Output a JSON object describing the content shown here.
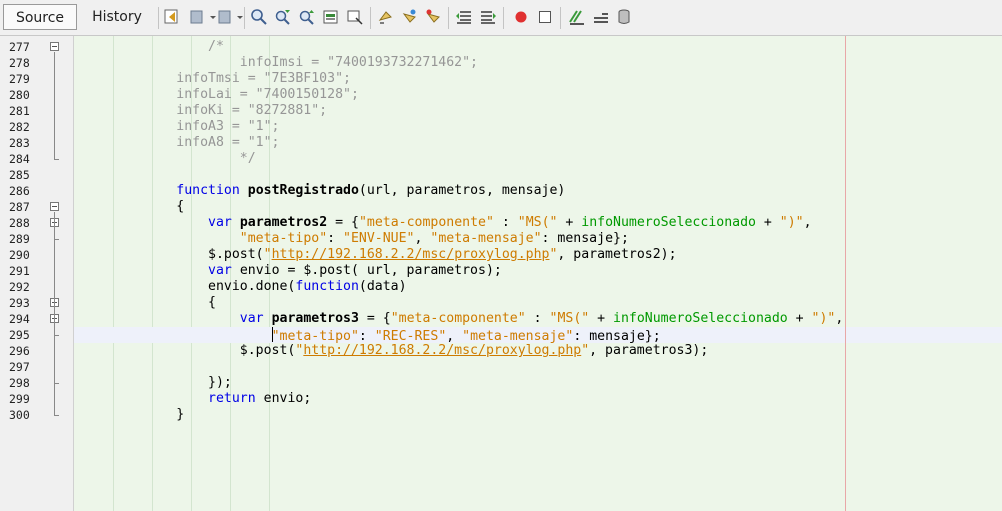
{
  "tabs": {
    "source": "Source",
    "history": "History"
  },
  "toolbar_icons": [
    "last-edit-icon",
    "back-icon",
    "forward-icon",
    "find-selection-icon",
    "find-previous-icon",
    "find-next-icon",
    "toggle-highlight-icon",
    "toggle-rect-selection-icon",
    "previous-bookmark-icon",
    "next-bookmark-icon",
    "toggle-bookmark-icon",
    "shift-left-icon",
    "shift-right-icon",
    "record-macro-icon",
    "stop-macro-icon",
    "comment-icon",
    "uncomment-icon",
    "database-icon"
  ],
  "lines": [
    {
      "n": "277",
      "tokens": [
        {
          "t": "                /*",
          "c": "cm"
        }
      ]
    },
    {
      "n": "278",
      "tokens": [
        {
          "t": "                    infoImsi = \"7400193732271462\";",
          "c": "cm"
        }
      ]
    },
    {
      "n": "279",
      "tokens": [
        {
          "t": "            infoTmsi = \"7E3BF103\";",
          "c": "cm"
        }
      ]
    },
    {
      "n": "280",
      "tokens": [
        {
          "t": "            infoLai = \"7400150128\";",
          "c": "cm"
        }
      ]
    },
    {
      "n": "281",
      "tokens": [
        {
          "t": "            infoKi = \"8272881\";",
          "c": "cm"
        }
      ]
    },
    {
      "n": "282",
      "tokens": [
        {
          "t": "            infoA3 = \"1\";",
          "c": "cm"
        }
      ]
    },
    {
      "n": "283",
      "tokens": [
        {
          "t": "            infoA8 = \"1\";",
          "c": "cm"
        }
      ]
    },
    {
      "n": "284",
      "tokens": [
        {
          "t": "                    */",
          "c": "cm"
        }
      ]
    },
    {
      "n": "285",
      "tokens": []
    },
    {
      "n": "286",
      "tokens": [
        {
          "t": "            "
        },
        {
          "t": "function",
          "c": "kw"
        },
        {
          "t": " "
        },
        {
          "t": "postRegistrado",
          "c": "fn"
        },
        {
          "t": "(url, parametros, mensaje)"
        }
      ]
    },
    {
      "n": "287",
      "tokens": [
        {
          "t": "            {"
        }
      ]
    },
    {
      "n": "288",
      "tokens": [
        {
          "t": "                "
        },
        {
          "t": "var",
          "c": "kw"
        },
        {
          "t": " "
        },
        {
          "t": "parametros2",
          "c": "fn"
        },
        {
          "t": " = {"
        },
        {
          "t": "\"meta-componente\"",
          "c": "str"
        },
        {
          "t": " : "
        },
        {
          "t": "\"MS(\"",
          "c": "str"
        },
        {
          "t": " + "
        },
        {
          "t": "infoNumeroSeleccionado",
          "c": "fld"
        },
        {
          "t": " + "
        },
        {
          "t": "\")\"",
          "c": "str"
        },
        {
          "t": ","
        }
      ]
    },
    {
      "n": "289",
      "tokens": [
        {
          "t": "                    "
        },
        {
          "t": "\"meta-tipo\"",
          "c": "str"
        },
        {
          "t": ": "
        },
        {
          "t": "\"ENV-NUE\"",
          "c": "str"
        },
        {
          "t": ", "
        },
        {
          "t": "\"meta-mensaje\"",
          "c": "str"
        },
        {
          "t": ": mensaje};"
        }
      ]
    },
    {
      "n": "290",
      "tokens": [
        {
          "t": "                $.post("
        },
        {
          "t": "\"",
          "c": "str"
        },
        {
          "t": "http://192.168.2.2/msc/proxylog.php",
          "c": "lnk"
        },
        {
          "t": "\"",
          "c": "str"
        },
        {
          "t": ", parametros2);"
        }
      ]
    },
    {
      "n": "291",
      "tokens": [
        {
          "t": "                "
        },
        {
          "t": "var",
          "c": "kw"
        },
        {
          "t": " envio = $.post( url, parametros);"
        }
      ]
    },
    {
      "n": "292",
      "tokens": [
        {
          "t": "                envio.done("
        },
        {
          "t": "function",
          "c": "kw"
        },
        {
          "t": "(data)"
        }
      ]
    },
    {
      "n": "293",
      "tokens": [
        {
          "t": "                {"
        }
      ]
    },
    {
      "n": "294",
      "tokens": [
        {
          "t": "                    "
        },
        {
          "t": "var",
          "c": "kw"
        },
        {
          "t": " "
        },
        {
          "t": "parametros3",
          "c": "fn"
        },
        {
          "t": " = {"
        },
        {
          "t": "\"meta-componente\"",
          "c": "str"
        },
        {
          "t": " : "
        },
        {
          "t": "\"MS(\"",
          "c": "str"
        },
        {
          "t": " + "
        },
        {
          "t": "infoNumeroSeleccionado",
          "c": "fld"
        },
        {
          "t": " + "
        },
        {
          "t": "\")\"",
          "c": "str"
        },
        {
          "t": ","
        }
      ]
    },
    {
      "n": "295",
      "tokens": [
        {
          "t": "                        "
        },
        {
          "t": "",
          "caret": true
        },
        {
          "t": "\"meta-tipo\"",
          "c": "str"
        },
        {
          "t": ": "
        },
        {
          "t": "\"REC-RES\"",
          "c": "str"
        },
        {
          "t": ", "
        },
        {
          "t": "\"meta-mensaje\"",
          "c": "str"
        },
        {
          "t": ": mensaje};"
        }
      ]
    },
    {
      "n": "296",
      "tokens": [
        {
          "t": "                    $.post("
        },
        {
          "t": "\"",
          "c": "str"
        },
        {
          "t": "http://192.168.2.2/msc/proxylog.php",
          "c": "lnk"
        },
        {
          "t": "\"",
          "c": "str"
        },
        {
          "t": ", parametros3);"
        }
      ]
    },
    {
      "n": "297",
      "tokens": []
    },
    {
      "n": "298",
      "tokens": [
        {
          "t": "                });"
        }
      ]
    },
    {
      "n": "299",
      "tokens": [
        {
          "t": "                "
        },
        {
          "t": "return",
          "c": "kw"
        },
        {
          "t": " envio;"
        }
      ]
    },
    {
      "n": "300",
      "tokens": [
        {
          "t": "            }"
        }
      ]
    }
  ],
  "folds": [
    {
      "n": "277",
      "kind": "start"
    },
    {
      "n": "284",
      "kind": "end"
    },
    {
      "n": "287",
      "kind": "start"
    },
    {
      "n": "288",
      "kind": "start"
    },
    {
      "n": "289",
      "kind": "end"
    },
    {
      "n": "293",
      "kind": "start"
    },
    {
      "n": "294",
      "kind": "start"
    },
    {
      "n": "295",
      "kind": "end"
    },
    {
      "n": "298",
      "kind": "end"
    },
    {
      "n": "300",
      "kind": "end"
    }
  ],
  "current_line": "295",
  "colors": {
    "keyword": "#0000e6",
    "string": "#ce7b00",
    "comment": "#969696",
    "field": "#009900",
    "background": "#edf6e9",
    "margin": "#e8a7a7"
  }
}
